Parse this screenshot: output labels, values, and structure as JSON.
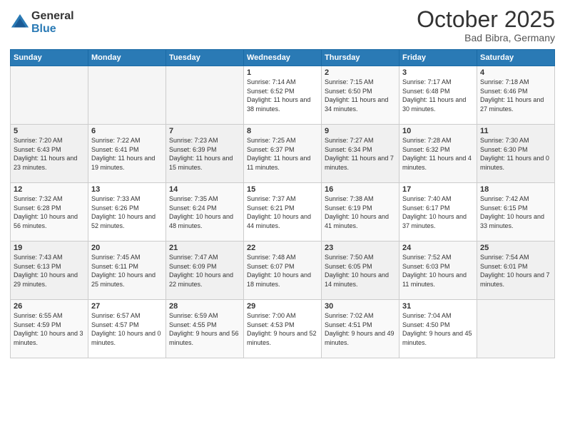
{
  "logo": {
    "general": "General",
    "blue": "Blue"
  },
  "header": {
    "month": "October 2025",
    "location": "Bad Bibra, Germany"
  },
  "weekdays": [
    "Sunday",
    "Monday",
    "Tuesday",
    "Wednesday",
    "Thursday",
    "Friday",
    "Saturday"
  ],
  "weeks": [
    [
      {
        "day": "",
        "sunrise": "",
        "sunset": "",
        "daylight": ""
      },
      {
        "day": "",
        "sunrise": "",
        "sunset": "",
        "daylight": ""
      },
      {
        "day": "",
        "sunrise": "",
        "sunset": "",
        "daylight": ""
      },
      {
        "day": "1",
        "sunrise": "Sunrise: 7:14 AM",
        "sunset": "Sunset: 6:52 PM",
        "daylight": "Daylight: 11 hours and 38 minutes."
      },
      {
        "day": "2",
        "sunrise": "Sunrise: 7:15 AM",
        "sunset": "Sunset: 6:50 PM",
        "daylight": "Daylight: 11 hours and 34 minutes."
      },
      {
        "day": "3",
        "sunrise": "Sunrise: 7:17 AM",
        "sunset": "Sunset: 6:48 PM",
        "daylight": "Daylight: 11 hours and 30 minutes."
      },
      {
        "day": "4",
        "sunrise": "Sunrise: 7:18 AM",
        "sunset": "Sunset: 6:46 PM",
        "daylight": "Daylight: 11 hours and 27 minutes."
      }
    ],
    [
      {
        "day": "5",
        "sunrise": "Sunrise: 7:20 AM",
        "sunset": "Sunset: 6:43 PM",
        "daylight": "Daylight: 11 hours and 23 minutes."
      },
      {
        "day": "6",
        "sunrise": "Sunrise: 7:22 AM",
        "sunset": "Sunset: 6:41 PM",
        "daylight": "Daylight: 11 hours and 19 minutes."
      },
      {
        "day": "7",
        "sunrise": "Sunrise: 7:23 AM",
        "sunset": "Sunset: 6:39 PM",
        "daylight": "Daylight: 11 hours and 15 minutes."
      },
      {
        "day": "8",
        "sunrise": "Sunrise: 7:25 AM",
        "sunset": "Sunset: 6:37 PM",
        "daylight": "Daylight: 11 hours and 11 minutes."
      },
      {
        "day": "9",
        "sunrise": "Sunrise: 7:27 AM",
        "sunset": "Sunset: 6:34 PM",
        "daylight": "Daylight: 11 hours and 7 minutes."
      },
      {
        "day": "10",
        "sunrise": "Sunrise: 7:28 AM",
        "sunset": "Sunset: 6:32 PM",
        "daylight": "Daylight: 11 hours and 4 minutes."
      },
      {
        "day": "11",
        "sunrise": "Sunrise: 7:30 AM",
        "sunset": "Sunset: 6:30 PM",
        "daylight": "Daylight: 11 hours and 0 minutes."
      }
    ],
    [
      {
        "day": "12",
        "sunrise": "Sunrise: 7:32 AM",
        "sunset": "Sunset: 6:28 PM",
        "daylight": "Daylight: 10 hours and 56 minutes."
      },
      {
        "day": "13",
        "sunrise": "Sunrise: 7:33 AM",
        "sunset": "Sunset: 6:26 PM",
        "daylight": "Daylight: 10 hours and 52 minutes."
      },
      {
        "day": "14",
        "sunrise": "Sunrise: 7:35 AM",
        "sunset": "Sunset: 6:24 PM",
        "daylight": "Daylight: 10 hours and 48 minutes."
      },
      {
        "day": "15",
        "sunrise": "Sunrise: 7:37 AM",
        "sunset": "Sunset: 6:21 PM",
        "daylight": "Daylight: 10 hours and 44 minutes."
      },
      {
        "day": "16",
        "sunrise": "Sunrise: 7:38 AM",
        "sunset": "Sunset: 6:19 PM",
        "daylight": "Daylight: 10 hours and 41 minutes."
      },
      {
        "day": "17",
        "sunrise": "Sunrise: 7:40 AM",
        "sunset": "Sunset: 6:17 PM",
        "daylight": "Daylight: 10 hours and 37 minutes."
      },
      {
        "day": "18",
        "sunrise": "Sunrise: 7:42 AM",
        "sunset": "Sunset: 6:15 PM",
        "daylight": "Daylight: 10 hours and 33 minutes."
      }
    ],
    [
      {
        "day": "19",
        "sunrise": "Sunrise: 7:43 AM",
        "sunset": "Sunset: 6:13 PM",
        "daylight": "Daylight: 10 hours and 29 minutes."
      },
      {
        "day": "20",
        "sunrise": "Sunrise: 7:45 AM",
        "sunset": "Sunset: 6:11 PM",
        "daylight": "Daylight: 10 hours and 25 minutes."
      },
      {
        "day": "21",
        "sunrise": "Sunrise: 7:47 AM",
        "sunset": "Sunset: 6:09 PM",
        "daylight": "Daylight: 10 hours and 22 minutes."
      },
      {
        "day": "22",
        "sunrise": "Sunrise: 7:48 AM",
        "sunset": "Sunset: 6:07 PM",
        "daylight": "Daylight: 10 hours and 18 minutes."
      },
      {
        "day": "23",
        "sunrise": "Sunrise: 7:50 AM",
        "sunset": "Sunset: 6:05 PM",
        "daylight": "Daylight: 10 hours and 14 minutes."
      },
      {
        "day": "24",
        "sunrise": "Sunrise: 7:52 AM",
        "sunset": "Sunset: 6:03 PM",
        "daylight": "Daylight: 10 hours and 11 minutes."
      },
      {
        "day": "25",
        "sunrise": "Sunrise: 7:54 AM",
        "sunset": "Sunset: 6:01 PM",
        "daylight": "Daylight: 10 hours and 7 minutes."
      }
    ],
    [
      {
        "day": "26",
        "sunrise": "Sunrise: 6:55 AM",
        "sunset": "Sunset: 4:59 PM",
        "daylight": "Daylight: 10 hours and 3 minutes."
      },
      {
        "day": "27",
        "sunrise": "Sunrise: 6:57 AM",
        "sunset": "Sunset: 4:57 PM",
        "daylight": "Daylight: 10 hours and 0 minutes."
      },
      {
        "day": "28",
        "sunrise": "Sunrise: 6:59 AM",
        "sunset": "Sunset: 4:55 PM",
        "daylight": "Daylight: 9 hours and 56 minutes."
      },
      {
        "day": "29",
        "sunrise": "Sunrise: 7:00 AM",
        "sunset": "Sunset: 4:53 PM",
        "daylight": "Daylight: 9 hours and 52 minutes."
      },
      {
        "day": "30",
        "sunrise": "Sunrise: 7:02 AM",
        "sunset": "Sunset: 4:51 PM",
        "daylight": "Daylight: 9 hours and 49 minutes."
      },
      {
        "day": "31",
        "sunrise": "Sunrise: 7:04 AM",
        "sunset": "Sunset: 4:50 PM",
        "daylight": "Daylight: 9 hours and 45 minutes."
      },
      {
        "day": "",
        "sunrise": "",
        "sunset": "",
        "daylight": ""
      }
    ]
  ]
}
